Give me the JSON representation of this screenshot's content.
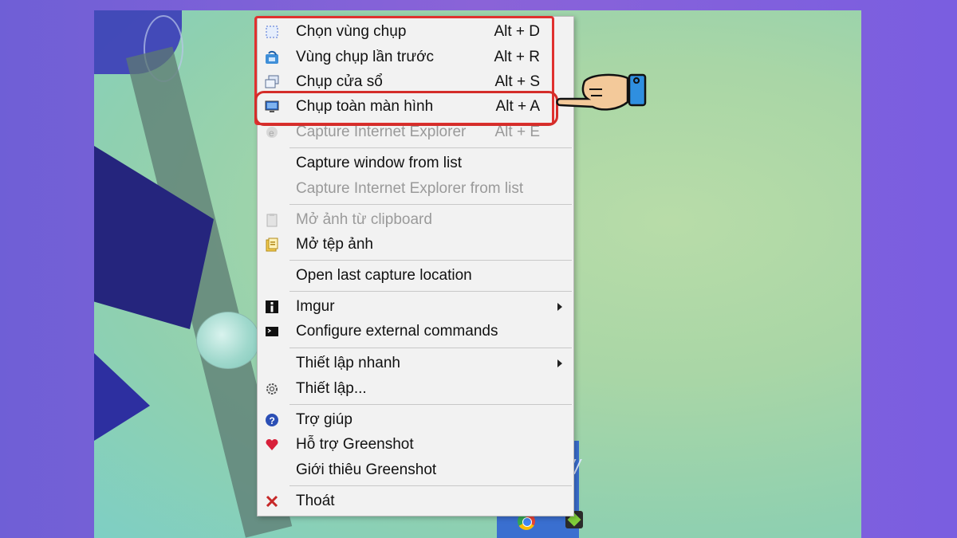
{
  "menu": {
    "items": [
      {
        "label": "Chọn vùng chụp",
        "shortcut": "Alt + D",
        "icon": "region-select-icon"
      },
      {
        "label": "Vùng chụp lần trước",
        "shortcut": "Alt + R",
        "icon": "last-region-icon"
      },
      {
        "label": "Chụp cửa sổ",
        "shortcut": "Alt + S",
        "icon": "window-capture-icon"
      },
      {
        "label": "Chụp toàn màn hình",
        "shortcut": "Alt + A",
        "icon": "fullscreen-capture-icon"
      },
      {
        "label": "Capture Internet Explorer",
        "shortcut": "Alt + E",
        "icon": "ie-icon"
      },
      {
        "label": "Capture window from list"
      },
      {
        "label": "Capture Internet Explorer from list"
      },
      {
        "label": "Mở ảnh từ clipboard",
        "icon": "clipboard-icon"
      },
      {
        "label": "Mở tệp ảnh",
        "icon": "open-file-icon"
      },
      {
        "label": "Open last capture location"
      },
      {
        "label": "Imgur",
        "icon": "imgur-icon"
      },
      {
        "label": "Configure external commands",
        "icon": "terminal-icon"
      },
      {
        "label": "Thiết lập nhanh"
      },
      {
        "label": "Thiết lập...",
        "icon": "gear-icon"
      },
      {
        "label": "Trợ giúp",
        "icon": "help-icon"
      },
      {
        "label": "Hỗ trợ Greenshot",
        "icon": "heart-icon"
      },
      {
        "label": "Giới thiêu Greenshot"
      },
      {
        "label": "Thoát",
        "icon": "close-icon"
      }
    ]
  },
  "colors": {
    "highlight": "#e0312f",
    "menu_bg": "#f2f2f2",
    "disabled_text": "#9a9a9a"
  }
}
